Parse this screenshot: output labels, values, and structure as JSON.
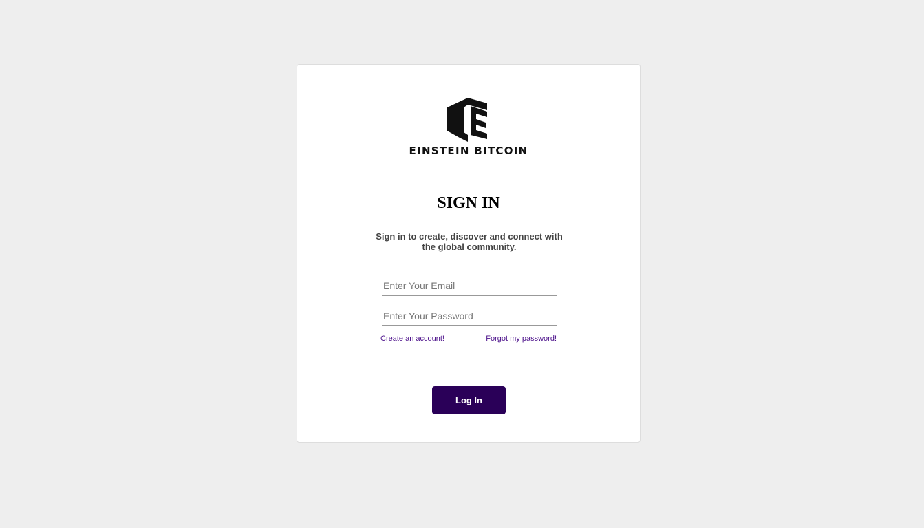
{
  "brand": {
    "logo_text": "EINSTEIN BITCOIN",
    "logo_icon": "einstein-bitcoin-e-cube-logo"
  },
  "form": {
    "title": "SIGN IN",
    "subtitle": "Sign in to create, discover and connect with the global community.",
    "email_placeholder": "Enter Your Email",
    "password_placeholder": "Enter Your Password",
    "create_account_link": "Create an account!",
    "forgot_password_link": "Forgot my password!",
    "login_button": "Log In"
  },
  "colors": {
    "page_background": "#eeeeee",
    "card_background": "#ffffff",
    "button_background": "#2a0058",
    "link_color": "#4b0f8a"
  }
}
